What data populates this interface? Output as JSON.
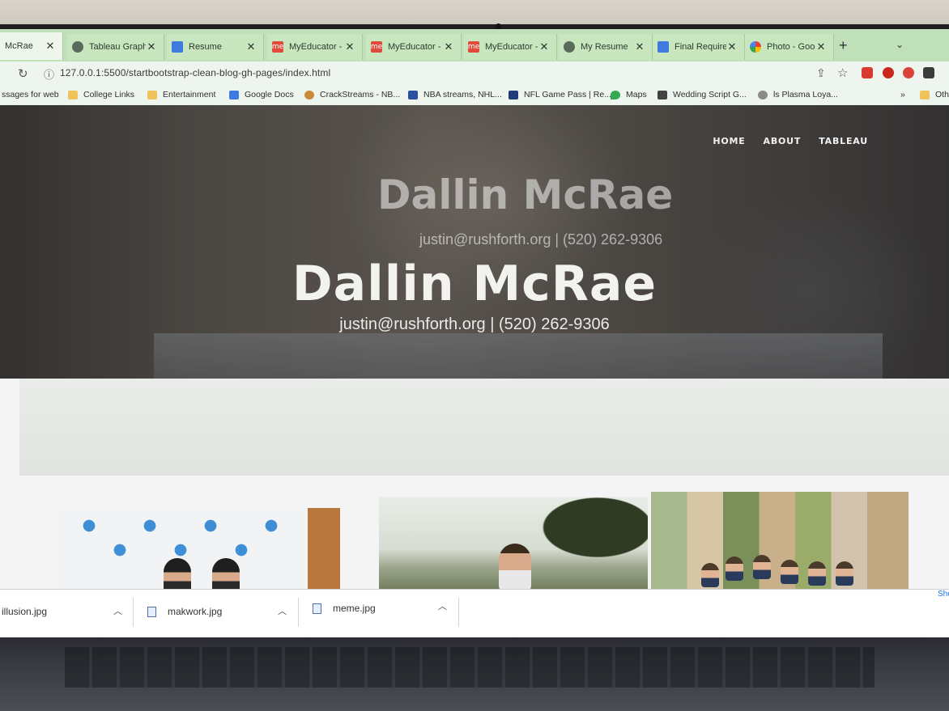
{
  "browser": {
    "tabs": [
      {
        "label": "McRae",
        "icon": "page-icon",
        "active": true
      },
      {
        "label": "Tableau Graph",
        "icon": "globe-icon"
      },
      {
        "label": "Resume",
        "icon": "docs-icon"
      },
      {
        "label": "MyEducator -",
        "icon": "myeducator-icon"
      },
      {
        "label": "MyEducator -",
        "icon": "myeducator-icon"
      },
      {
        "label": "MyEducator -",
        "icon": "myeducator-icon"
      },
      {
        "label": "My Resume",
        "icon": "globe-icon"
      },
      {
        "label": "Final Requirem",
        "icon": "docs-icon"
      },
      {
        "label": "Photo - Goog",
        "icon": "google-photos-icon"
      }
    ],
    "new_tab": "+",
    "url": "127.0.0.1:5500/startbootstrap-clean-blog-gh-pages/index.html",
    "bookmarks": [
      {
        "label": "ssages for web",
        "icon": "none"
      },
      {
        "label": "College Links",
        "icon": "folder-icon"
      },
      {
        "label": "Entertainment",
        "icon": "folder-icon"
      },
      {
        "label": "Google Docs",
        "icon": "docs-icon"
      },
      {
        "label": "CrackStreams - NB...",
        "icon": "crackstreams-icon"
      },
      {
        "label": "NBA streams, NHL...",
        "icon": "nba-icon"
      },
      {
        "label": "NFL Game Pass | Re...",
        "icon": "nfl-icon"
      },
      {
        "label": "Maps",
        "icon": "maps-icon"
      },
      {
        "label": "Wedding Script G...",
        "icon": "page-icon"
      },
      {
        "label": "ls Plasma Loya...",
        "icon": "page-icon"
      }
    ],
    "bookmarks_overflow": "»",
    "other_bookmarks": "Oth"
  },
  "site": {
    "nav": [
      "HOME",
      "ABOUT",
      "TABLEAU"
    ],
    "title": "Dallin McRae",
    "subtitle": "justin@rushforth.org | (520) 262-9306",
    "ghost_title": "Dallin McRae",
    "ghost_subtitle": "justin@rushforth.org | (520) 262-9306"
  },
  "downloads": [
    {
      "name": "illusion.jpg"
    },
    {
      "name": "makwork.jpg"
    },
    {
      "name": "meme.jpg"
    }
  ],
  "downloads_show_all": "Sho",
  "colors": {
    "tab_strip": "#bfe0b8",
    "toolbar": "#eef4ee",
    "hero_text": "#f2f2ee",
    "page_bg": "#f6f7f6"
  }
}
